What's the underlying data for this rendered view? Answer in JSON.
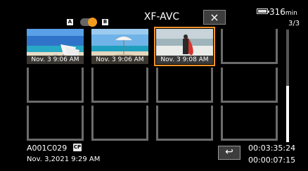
{
  "header": {
    "slot_a": "A",
    "slot_b": "B",
    "title": "XF-AVC",
    "close_label": "×",
    "battery_minutes": "316",
    "battery_unit": "min",
    "page_indicator": "3/3"
  },
  "thumbnails": [
    {
      "caption": "Nov. 3  9:06 AM",
      "scene": "beach-chairs"
    },
    {
      "caption": "Nov. 3  9:06 AM",
      "scene": "beach-umbrella"
    },
    {
      "caption": "Nov. 3  9:08 AM",
      "scene": "surfer",
      "selected": true
    }
  ],
  "scroll": {
    "position_fraction": 0.5,
    "visible_fraction": 0.5
  },
  "footer": {
    "clip_name": "A001C029",
    "cp_badge": "CP",
    "clip_datetime": "Nov. 3,2021  9:29 AM",
    "return_icon": "↩",
    "total_time": "00:03:35:24",
    "clip_duration": "00:00:07:15"
  },
  "colors": {
    "selection": "#f2922a",
    "toggle_knob": "#f29c1f",
    "grid_frame": "#6b6b6b"
  }
}
